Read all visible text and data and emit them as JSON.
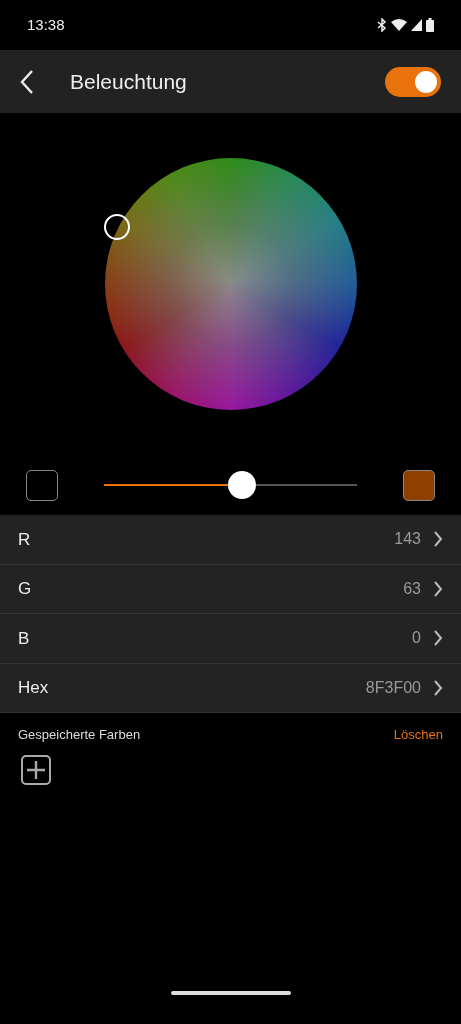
{
  "status_bar": {
    "time": "13:38"
  },
  "header": {
    "title": "Beleuchtung",
    "toggle": {
      "on": true
    }
  },
  "brightness": {
    "level": 0.545
  },
  "values": [
    {
      "label": "R",
      "value": "143"
    },
    {
      "label": "G",
      "value": "63"
    },
    {
      "label": "B",
      "value": "0"
    },
    {
      "label": "Hex",
      "value": "8F3F00"
    }
  ],
  "saved_colors": {
    "title": "Gespeicherte Farben",
    "clear": "Löschen"
  }
}
